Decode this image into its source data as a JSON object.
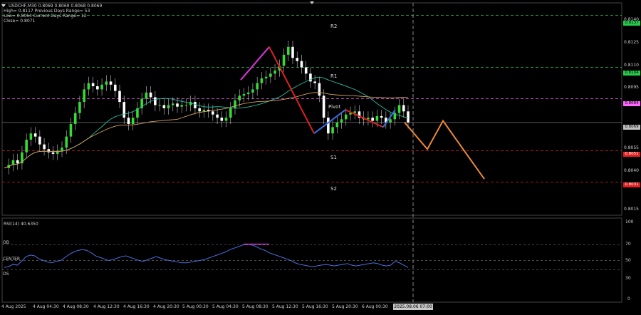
{
  "header": {
    "symbol_line": "USDCHF,M30  0.8069 0.8069 0.8068 0.8069",
    "line2": "High= 0.8117      Previous Days Range= 53",
    "line3": "Low= 0.8064       Current Days Range= 12",
    "line4": "Close= 0.8071"
  },
  "rsi": {
    "label": "RSI(14) 40.6350",
    "ob": "OB",
    "os": "OS",
    "center": "CENTER",
    "ticks": [
      "100",
      "70",
      "50",
      "30",
      "0"
    ]
  },
  "pivots": {
    "r2": "R2",
    "r1": "R1",
    "pivot": "Pivot",
    "s1": "S1",
    "s2": "S2"
  },
  "price_tags": {
    "r2": "0.8137",
    "r1": "0.8104",
    "pivot": "0.8084",
    "current": "0.8069",
    "s1": "0.8051",
    "s2": "0.8031"
  },
  "colors": {
    "r_tag": "#27c94a",
    "pivot_tag": "#ff66ff",
    "s_tag": "#e02020",
    "current_tag": "#c0c0c0"
  },
  "y_axis": [
    "0.8140",
    "0.8125",
    "0.8110",
    "0.8095",
    "0.8055",
    "0.8040",
    "0.8015"
  ],
  "x_axis": [
    "4 Aug 2025",
    "4 Aug 04:30",
    "4 Aug 08:30",
    "4 Aug 12:30",
    "4 Aug 16:30",
    "4 Aug 20:30",
    "5 Aug 00:30",
    "5 Aug 04:30",
    "5 Aug 08:30",
    "5 Aug 12:30",
    "5 Aug 16:30",
    "5 Aug 20:30",
    "6 Aug 00:30"
  ],
  "cursor_time": "2025.08.06 07:00",
  "chart_data": {
    "type": "candlestick",
    "symbol": "USDCHF",
    "timeframe": "M30",
    "ylim": [
      0.801,
      0.8145
    ],
    "close_series": [
      0.804,
      0.8042,
      0.8045,
      0.8043,
      0.805,
      0.8058,
      0.8062,
      0.806,
      0.8055,
      0.8052,
      0.805,
      0.8049,
      0.8051,
      0.8053,
      0.806,
      0.8068,
      0.8075,
      0.8082,
      0.809,
      0.8094,
      0.8092,
      0.809,
      0.8093,
      0.8095,
      0.8093,
      0.8089,
      0.8082,
      0.8072,
      0.8068,
      0.8072,
      0.8078,
      0.8084,
      0.8088,
      0.8085,
      0.808,
      0.808,
      0.8078,
      0.808,
      0.8081,
      0.8079,
      0.808,
      0.808,
      0.8082,
      0.8078,
      0.8076,
      0.8077,
      0.8076,
      0.8074,
      0.8072,
      0.807,
      0.8072,
      0.8078,
      0.8083,
      0.8086,
      0.8087,
      0.8088,
      0.809,
      0.8094,
      0.8097,
      0.8098,
      0.81,
      0.8102,
      0.8105,
      0.8112,
      0.8117,
      0.811,
      0.8108,
      0.8104,
      0.81,
      0.8095,
      0.8094,
      0.8086,
      0.8072,
      0.8062,
      0.8066,
      0.8069,
      0.8071,
      0.8074,
      0.8075,
      0.8076,
      0.8072,
      0.8071,
      0.8072,
      0.807,
      0.8073,
      0.8072,
      0.8069,
      0.8071,
      0.8075,
      0.808,
      0.8076,
      0.8069
    ],
    "projection_path": [
      0.8069,
      0.8052,
      0.807,
      0.8033
    ],
    "rsi_series": [
      41,
      42,
      45,
      44,
      49,
      55,
      57,
      56,
      52,
      50,
      48,
      47,
      49,
      50,
      54,
      58,
      61,
      63,
      64,
      63,
      60,
      56,
      54,
      52,
      50,
      51,
      53,
      55,
      56,
      54,
      52,
      50,
      49,
      51,
      53,
      55,
      53,
      51,
      50,
      49,
      48,
      47,
      47,
      48,
      49,
      50,
      51,
      53,
      55,
      57,
      59,
      61,
      64,
      66,
      68,
      70,
      71,
      70,
      68,
      65,
      63,
      60,
      58,
      56,
      54,
      52,
      50,
      47,
      45,
      44,
      43,
      42,
      43,
      44,
      45,
      44,
      43,
      44,
      45,
      46,
      44,
      43,
      44,
      45,
      46,
      47,
      46,
      44,
      43,
      44,
      49,
      47,
      44,
      41
    ],
    "rsi_levels": {
      "ob": 70,
      "center": 50,
      "os": 38
    }
  }
}
